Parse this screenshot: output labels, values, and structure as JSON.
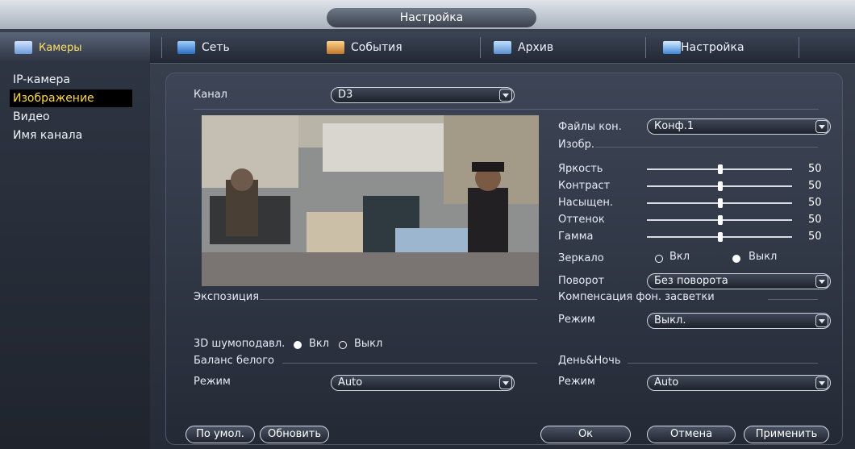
{
  "window": {
    "title": "Настройка"
  },
  "tabs": [
    {
      "label": "Камеры",
      "icon": "camera-icon"
    },
    {
      "label": "Сеть",
      "icon": "network-icon"
    },
    {
      "label": "События",
      "icon": "events-icon"
    },
    {
      "label": "Архив",
      "icon": "archive-icon"
    },
    {
      "label": "Настройка",
      "icon": "settings-icon"
    }
  ],
  "sidebar": {
    "items": [
      {
        "label": "IP-камера"
      },
      {
        "label": "Изображение"
      },
      {
        "label": "Видео"
      },
      {
        "label": "Имя канала"
      }
    ],
    "active_index": 1
  },
  "channel": {
    "label": "Канал",
    "value": "D3"
  },
  "profile": {
    "label": "Файлы кон.",
    "value": "Конф.1"
  },
  "image_section": {
    "title": "Изобр."
  },
  "sliders": [
    {
      "label": "Яркость",
      "value": "50",
      "level": 0.5
    },
    {
      "label": "Контраст",
      "value": "50",
      "level": 0.5
    },
    {
      "label": "Насыщен.",
      "value": "50",
      "level": 0.5
    },
    {
      "label": "Оттенок",
      "value": "50",
      "level": 0.5
    },
    {
      "label": "Гамма",
      "value": "50",
      "level": 0.5
    }
  ],
  "mirror": {
    "label": "Зеркало",
    "on_label": "Вкл",
    "off_label": "Выкл",
    "selected": "off"
  },
  "rotate": {
    "label": "Поворот",
    "value": "Без поворота"
  },
  "backlight": {
    "title": "Компенсация фон. засветки",
    "mode_label": "Режим",
    "mode_value": "Выкл."
  },
  "exposure": {
    "title": "Экспозиция"
  },
  "noise": {
    "label": "3D шумоподавл.",
    "on_label": "Вкл",
    "off_label": "Выкл",
    "selected": "on"
  },
  "white_balance": {
    "title": "Баланс белого",
    "mode_label": "Режим",
    "mode_value": "Auto"
  },
  "day_night": {
    "title": "День&Ночь",
    "mode_label": "Режим",
    "mode_value": "Auto"
  },
  "buttons": {
    "default": "По умол.",
    "refresh": "Обновить",
    "ok": "Ок",
    "cancel": "Отмена",
    "apply": "Применить"
  },
  "colors": {
    "accent_text": "#ffd84a",
    "panel_bg": "#2f3644"
  }
}
